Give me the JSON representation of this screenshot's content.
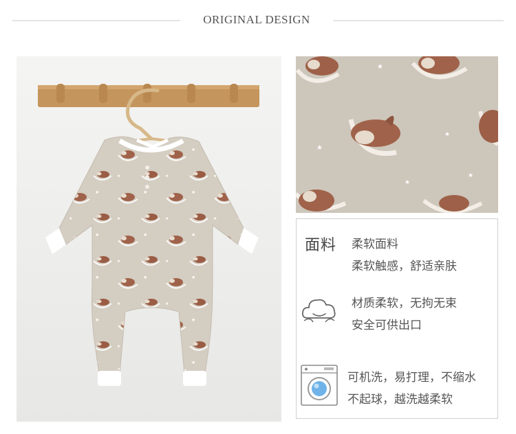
{
  "header": {
    "title": "ORIGINAL DESIGN"
  },
  "features": {
    "fabric": {
      "label": "面料",
      "line1": "柔软面料",
      "line2": "柔软触感，舒适亲肤",
      "icon": "fabric-label-text"
    },
    "soft": {
      "line1": "材质柔软，无拘无束",
      "line2": "安全可供出口",
      "icon": "cloud-icon"
    },
    "wash": {
      "line1": "可机洗，易打理，不缩水",
      "line2": "不起球，越洗越柔软",
      "icon": "washing-machine-icon"
    }
  },
  "colors": {
    "fabric": "#cdc6bb",
    "wood": "#c4955c",
    "cuff": "#ffffff",
    "fox": "#a0624a",
    "accent_blue": "#6fb3e8"
  }
}
